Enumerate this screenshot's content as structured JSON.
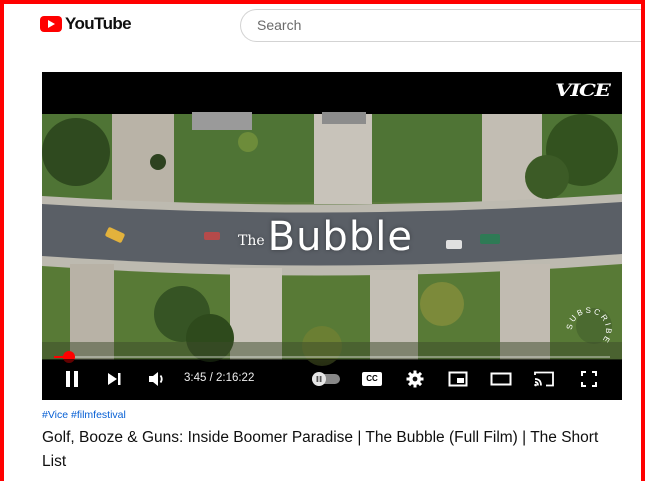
{
  "header": {
    "logo_text": "YouTube",
    "search_placeholder": "Search"
  },
  "video": {
    "channel_watermark": "VICE",
    "overlay_title_prefix": "The",
    "overlay_title": "Bubble",
    "subscribe_ring_text": "SUBSCRIBE",
    "progress_fraction": 0.027,
    "time_current": "3:45",
    "time_separator": " / ",
    "time_total": "2:16:22",
    "controls": {
      "pause_icon": "pause-icon",
      "next_icon": "next-icon",
      "volume_icon": "volume-icon",
      "autoplay_icon": "autoplay-toggle-icon",
      "captions_label": "CC",
      "settings_icon": "gear-icon",
      "miniplayer_icon": "miniplayer-icon",
      "theater_icon": "theater-icon",
      "cast_icon": "cast-icon",
      "fullscreen_icon": "fullscreen-icon"
    }
  },
  "details": {
    "hashtags": "#Vice #filmfestival",
    "title": "Golf, Booze & Guns: Inside Boomer Paradise | The Bubble (Full Film) | The Short List"
  },
  "colors": {
    "accent": "#ff0000",
    "link": "#065fd4",
    "text": "#0f0f0f"
  }
}
